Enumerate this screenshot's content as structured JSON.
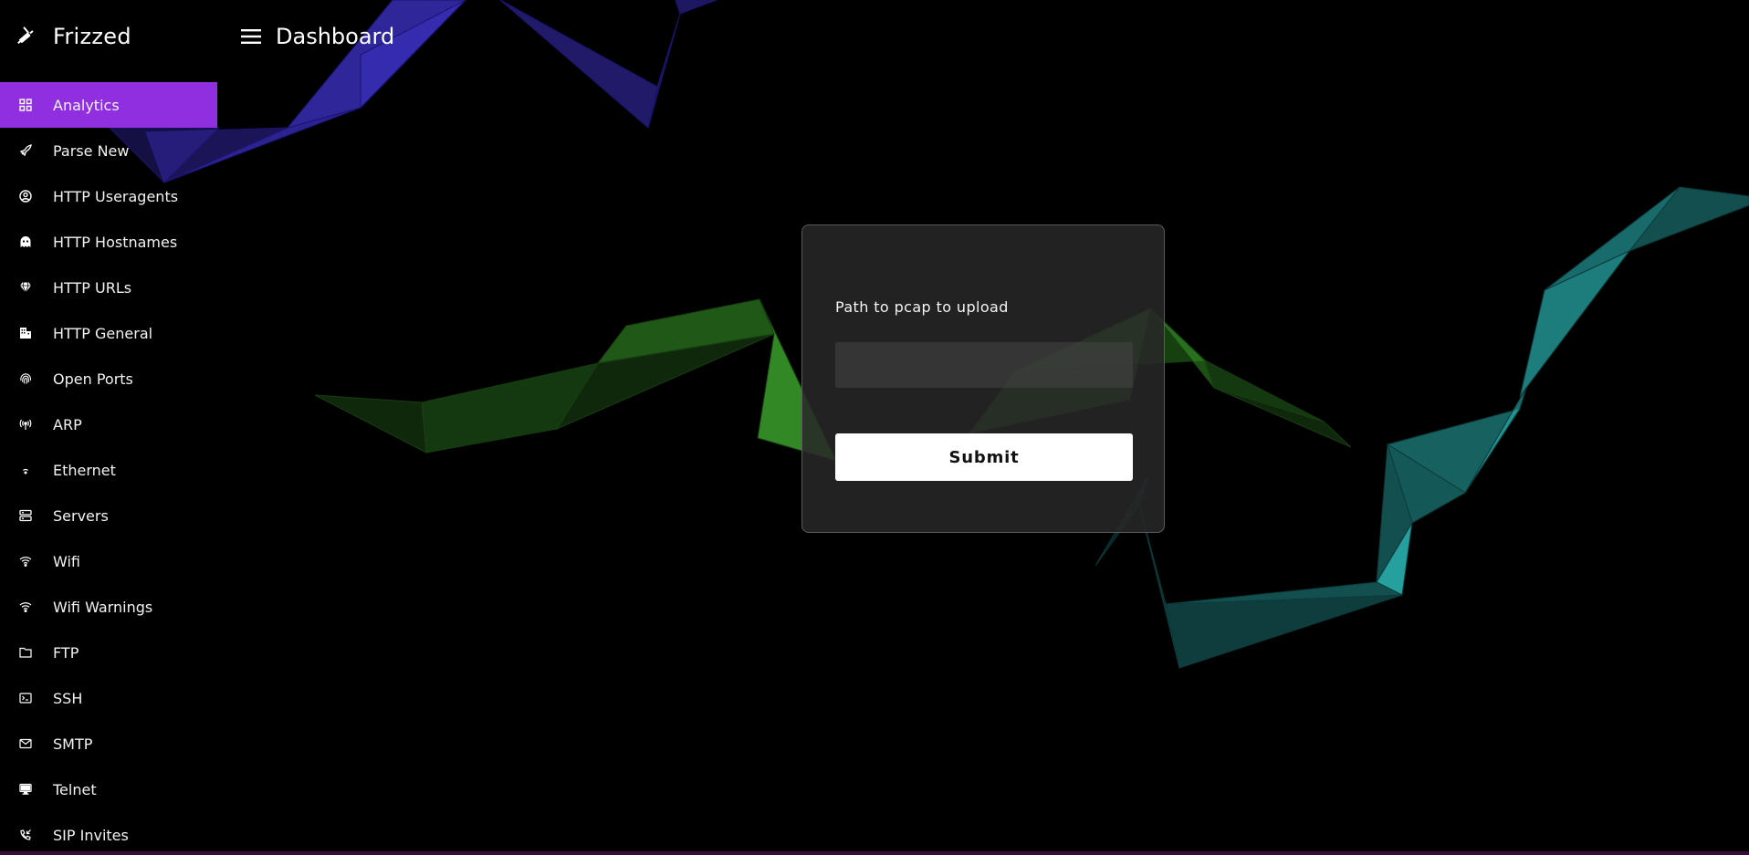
{
  "app": {
    "brand_name": "Frizzed",
    "brand_icon": "syringe-icon",
    "page_title": "Dashboard",
    "menu_icon": "hamburger-icon"
  },
  "sidebar": {
    "active_color": "#8f2fe0",
    "items": [
      {
        "label": "Analytics",
        "icon": "grid-icon",
        "active": true
      },
      {
        "label": "Parse New",
        "icon": "rocket-icon",
        "active": false
      },
      {
        "label": "HTTP Useragents",
        "icon": "user-circle-icon",
        "active": false
      },
      {
        "label": "HTTP Hostnames",
        "icon": "ghost-icon",
        "active": false
      },
      {
        "label": "HTTP URLs",
        "icon": "diamond-icon",
        "active": false
      },
      {
        "label": "HTTP General",
        "icon": "building-icon",
        "active": false
      },
      {
        "label": "Open Ports",
        "icon": "fingerprint-icon",
        "active": false
      },
      {
        "label": "ARP",
        "icon": "antenna-icon",
        "active": false
      },
      {
        "label": "Ethernet",
        "icon": "wifi-dot-icon",
        "active": false
      },
      {
        "label": "Servers",
        "icon": "server-icon",
        "active": false
      },
      {
        "label": "Wifi",
        "icon": "wifi-icon",
        "active": false
      },
      {
        "label": "Wifi Warnings",
        "icon": "wifi-icon",
        "active": false
      },
      {
        "label": "FTP",
        "icon": "folder-icon",
        "active": false
      },
      {
        "label": "SSH",
        "icon": "terminal-icon",
        "active": false
      },
      {
        "label": "SMTP",
        "icon": "mail-icon",
        "active": false
      },
      {
        "label": "Telnet",
        "icon": "monitor-icon",
        "active": false
      },
      {
        "label": "SIP Invites",
        "icon": "phone-incoming-icon",
        "active": false
      }
    ]
  },
  "upload_form": {
    "label": "Path to pcap to upload",
    "input_value": "",
    "input_placeholder": "",
    "submit_label": "Submit"
  }
}
